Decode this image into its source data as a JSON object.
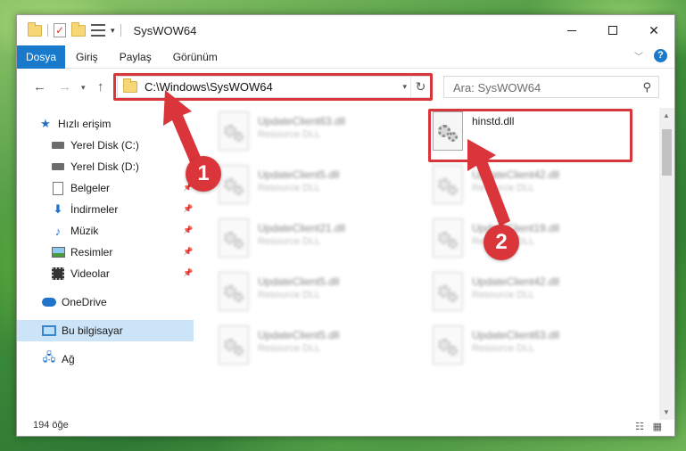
{
  "window": {
    "title": "SysWOW64",
    "controls": {
      "minimize": "minimize-icon",
      "maximize": "maximize-icon",
      "close": "✕"
    }
  },
  "ribbon": {
    "tabs": [
      "Dosya",
      "Giriş",
      "Paylaş",
      "Görünüm"
    ],
    "active_tab": "Dosya",
    "help": "?"
  },
  "navigation": {
    "address": "C:\\Windows\\SysWOW64",
    "search_placeholder": "Ara: SysWOW64"
  },
  "sidebar": {
    "items": [
      {
        "label": "Hızlı erişim",
        "icon": "star-icon"
      },
      {
        "label": "Yerel Disk (C:)",
        "icon": "drive-icon",
        "pinned": true
      },
      {
        "label": "Yerel Disk (D:)",
        "icon": "drive-icon",
        "pinned": true
      },
      {
        "label": "Belgeler",
        "icon": "documents-icon",
        "pinned": true
      },
      {
        "label": "İndirmeler",
        "icon": "download-icon",
        "pinned": true
      },
      {
        "label": "Müzik",
        "icon": "music-icon",
        "pinned": true
      },
      {
        "label": "Resimler",
        "icon": "pictures-icon",
        "pinned": true
      },
      {
        "label": "Videolar",
        "icon": "videos-icon",
        "pinned": true
      },
      {
        "label": "OneDrive",
        "icon": "cloud-icon"
      },
      {
        "label": "Bu bilgisayar",
        "icon": "computer-icon",
        "selected": true
      },
      {
        "label": "Ağ",
        "icon": "network-icon"
      }
    ]
  },
  "files": {
    "left_column": [
      {
        "name": "UpdateClient63.dll",
        "type": "Resource DLL"
      },
      {
        "name": "UpdateClient5.dll",
        "type": "Resource DLL"
      },
      {
        "name": "UpdateClient21.dll",
        "type": "Resource DLL"
      },
      {
        "name": "UpdateClient5.dll",
        "type": "Resource DLL"
      },
      {
        "name": "UpdateClient5.dll",
        "type": "Resource DLL"
      }
    ],
    "right_column": [
      {
        "name": "hinstd.dll",
        "type": ""
      },
      {
        "name": "UpdateClient42.dll",
        "type": "Resource DLL"
      },
      {
        "name": "UpdateClient19.dll",
        "type": "Resource DLL"
      },
      {
        "name": "UpdateClient42.dll",
        "type": "Resource DLL"
      },
      {
        "name": "UpdateClient63.dll",
        "type": "Resource DLL"
      }
    ],
    "highlighted": "hinstd.dll"
  },
  "status": {
    "item_count": "194 öğe"
  },
  "annotations": {
    "step1": "1",
    "step2": "2",
    "color": "#d9353a"
  }
}
